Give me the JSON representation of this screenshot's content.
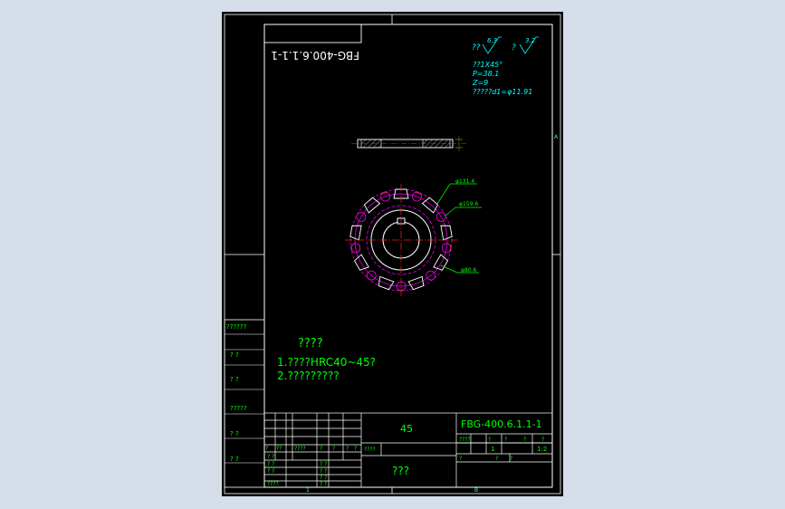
{
  "drawing": {
    "code_mirrored": "FBG-400.6.1.1-1",
    "surface": {
      "label_a": "??",
      "value_a": "6.3",
      "label_b": "?",
      "value_b": "3.2"
    },
    "specs": [
      "??1X45°",
      "P=38.1",
      "Z=9",
      "?????d1=φ11.91"
    ],
    "dimensions": [
      "φ131.4",
      "φ159.6",
      "φ80.6"
    ],
    "zone_marks": {
      "right_top": "A",
      "bottom": "B",
      "bottom_left": "1"
    },
    "notes": {
      "title": "????",
      "line1": "1.????HRC40~45?",
      "line2": "2.?????????"
    },
    "left_strip": [
      "??????",
      "?  ?",
      "?  ?",
      "?????",
      "?  ?",
      "?  ?"
    ]
  },
  "title_block": {
    "material": "45",
    "drawing_code": "FBG-400.6.1.1-1",
    "part_name": "???",
    "attr_row_labels": [
      "????",
      "?",
      "?",
      "?",
      "?"
    ],
    "attr_values": [
      "1",
      "1:2"
    ],
    "rev_headers": [
      "?",
      "??",
      "????",
      "?",
      "?",
      "?",
      "?"
    ],
    "design_label": "????",
    "sign_rows": [
      "? ?",
      "? ?",
      "? ?",
      "????"
    ],
    "sign_rows_b": [
      "? ?",
      "? ?",
      "? ?",
      "? ?"
    ],
    "bottom_row": [
      "?",
      "?",
      "?"
    ]
  },
  "colors": {
    "outline": "#00ffff",
    "part": "#ffffff",
    "text_green": "#00ff00",
    "center": "#ff2020",
    "magenta": "#ff00ff"
  }
}
